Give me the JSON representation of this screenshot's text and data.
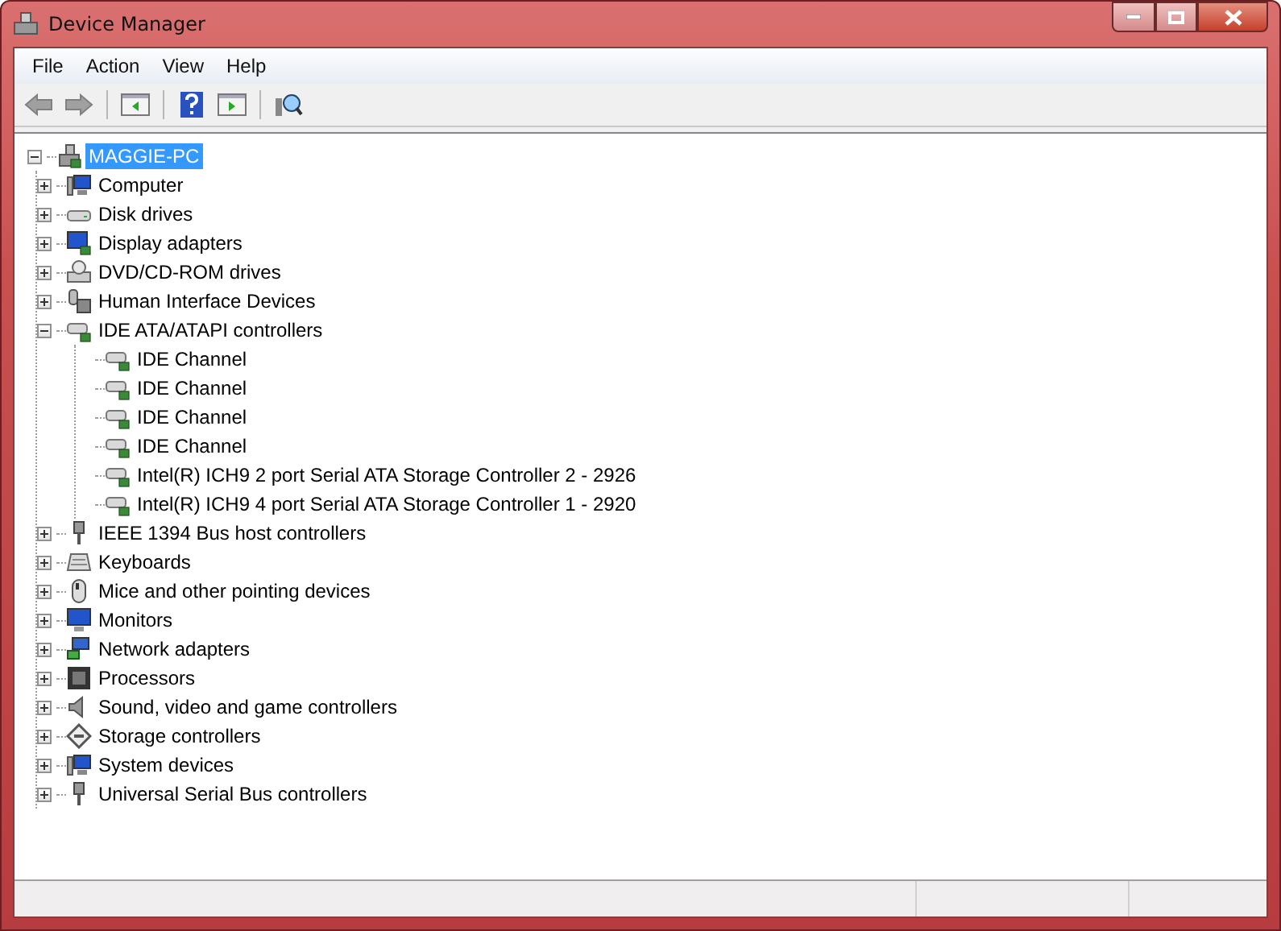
{
  "window": {
    "title": "Device Manager"
  },
  "menu": [
    {
      "label": "File"
    },
    {
      "label": "Action"
    },
    {
      "label": "View"
    },
    {
      "label": "Help"
    }
  ],
  "tree": {
    "label": "MAGGIE-PC",
    "kind": "pc",
    "expanded": true,
    "selected": true,
    "children": [
      {
        "label": "Computer",
        "kind": "computer",
        "expanded": false
      },
      {
        "label": "Disk drives",
        "kind": "disk",
        "expanded": false
      },
      {
        "label": "Display adapters",
        "kind": "display",
        "expanded": false
      },
      {
        "label": "DVD/CD-ROM drives",
        "kind": "dvd",
        "expanded": false
      },
      {
        "label": "Human Interface Devices",
        "kind": "hid",
        "expanded": false
      },
      {
        "label": "IDE ATA/ATAPI controllers",
        "kind": "ide",
        "expanded": true,
        "children": [
          {
            "label": "IDE Channel",
            "kind": "ide"
          },
          {
            "label": "IDE Channel",
            "kind": "ide"
          },
          {
            "label": "IDE Channel",
            "kind": "ide"
          },
          {
            "label": "IDE Channel",
            "kind": "ide"
          },
          {
            "label": "Intel(R) ICH9 2 port Serial ATA Storage Controller 2 - 2926",
            "kind": "ide"
          },
          {
            "label": "Intel(R) ICH9 4 port Serial ATA Storage Controller 1 - 2920",
            "kind": "ide"
          }
        ]
      },
      {
        "label": "IEEE 1394 Bus host controllers",
        "kind": "plug",
        "expanded": false
      },
      {
        "label": "Keyboards",
        "kind": "keyboard",
        "expanded": false
      },
      {
        "label": "Mice and other pointing devices",
        "kind": "mouse",
        "expanded": false
      },
      {
        "label": "Monitors",
        "kind": "monitor",
        "expanded": false
      },
      {
        "label": "Network adapters",
        "kind": "network",
        "expanded": false
      },
      {
        "label": "Processors",
        "kind": "processor",
        "expanded": false
      },
      {
        "label": "Sound, video and game controllers",
        "kind": "sound",
        "expanded": false
      },
      {
        "label": "Storage controllers",
        "kind": "storage",
        "expanded": false
      },
      {
        "label": "System devices",
        "kind": "computer",
        "expanded": false
      },
      {
        "label": "Universal Serial Bus controllers",
        "kind": "plug",
        "expanded": false
      }
    ]
  }
}
